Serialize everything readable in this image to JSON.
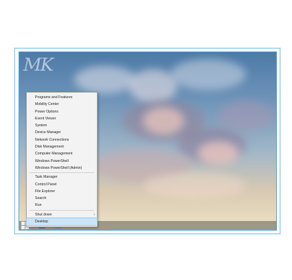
{
  "watermark": "MK",
  "menu": {
    "group1": [
      "Programs and Features",
      "Mobility Center",
      "Power Options",
      "Event Viewer",
      "System",
      "Device Manager",
      "Network Connections",
      "Disk Management",
      "Computer Management",
      "Windows PowerShell",
      "Windows PowerShell (Admin)"
    ],
    "group2": [
      "Task Manager",
      "Control Panel",
      "File Explorer",
      "Search",
      "Run"
    ],
    "shutdown": "Shut down",
    "shutdown_arrow": "›",
    "desktop": "Desktop"
  },
  "colors": {
    "menu_highlight": "#cce4f7",
    "frame_border": "#4aa8e0"
  }
}
